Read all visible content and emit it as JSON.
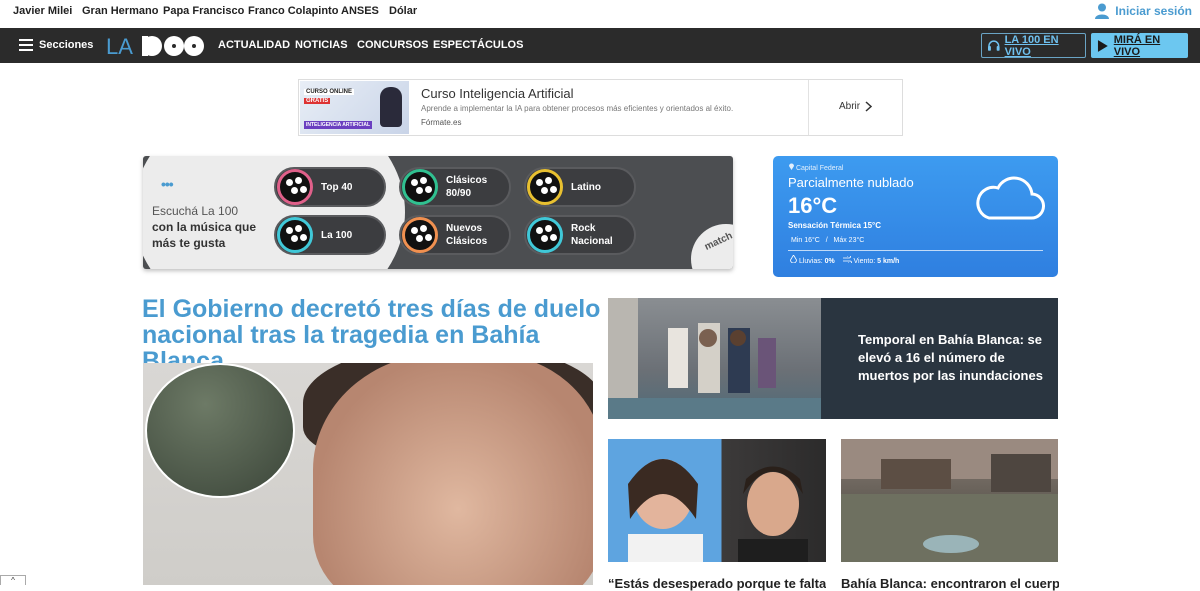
{
  "trending": [
    "Javier Milei",
    "Gran Hermano",
    "Papa Francisco",
    "Franco Colapinto",
    "ANSES",
    "Dólar"
  ],
  "login_label": "Iniciar sesión",
  "nav": {
    "sections_label": "Secciones",
    "logo_text": "LA 100",
    "links": [
      "ACTUALIDAD",
      "NOTICIAS",
      "CONCURSOS",
      "ESPECTÁCULOS"
    ],
    "radio_button": "LA 100 EN VIVO",
    "live_button": "MIRÁ EN VIVO"
  },
  "ad": {
    "image_line1": "CURSO ONLINE",
    "image_line2": "GRATIS",
    "image_line3": "INTELIGENCIA ARTIFICIAL",
    "title": "Curso Inteligencia Artificial",
    "description": "Aprende a implementar la IA para obtener procesos más eficientes y orientados al éxito.",
    "source": "Fórmate.es",
    "cta": "Abrir"
  },
  "match": {
    "dots": "•••",
    "intro": "Escuchá La 100",
    "intro_bold": "con la música que más te gusta",
    "badge": "match 100",
    "stations": [
      {
        "label": "Top 40",
        "color": "#e0608a"
      },
      {
        "label": "Clásicos 80/90",
        "color": "#30c090"
      },
      {
        "label": "Latino",
        "color": "#e8c030"
      },
      {
        "label": "La 100",
        "color": "#40c8d8"
      },
      {
        "label": "Nuevos Clásicos",
        "color": "#f09050"
      },
      {
        "label": "Rock Nacional",
        "color": "#40c8d8"
      }
    ]
  },
  "weather": {
    "location": "Capital Federal",
    "condition": "Parcialmente nublado",
    "temperature": "16°C",
    "feels_like": "Sensación Térmica 15°C",
    "min": "Min 16°C",
    "separator": "/",
    "max": "Máx 23°C",
    "rain_label": "Lluvias:",
    "rain_value": "0%",
    "wind_label": "Viento:",
    "wind_value": "5 km/h"
  },
  "main_headline": "El Gobierno decretó tres días de duelo nacional tras la tragedia en Bahía Blanca",
  "side_story": "Temporal en Bahía Blanca: se elevó a 16 el número de muertos por las inundaciones",
  "bottom_captions": [
    "“Estás desesperado porque te faltan",
    "Bahía Blanca: encontraron el cuerpo"
  ],
  "scroll_up": "^"
}
